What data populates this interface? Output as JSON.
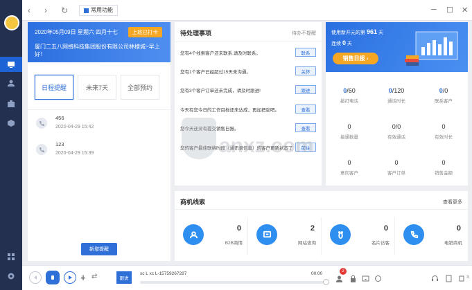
{
  "topbar": {
    "common_label": "常用功能"
  },
  "left": {
    "date_line": "2020年05月09日 星期六 四月十七",
    "checkin": "上班已打卡",
    "company": "厦门二五八网络科技集团股份有限公司林棣城~早上好！",
    "tabs": [
      "日程提醒",
      "未来7天",
      "全部预约"
    ],
    "reminders": [
      {
        "name": "456",
        "time": "2020-04-29 15:42"
      },
      {
        "name": "123",
        "time": "2020-04-29 15:39"
      }
    ],
    "add_button": "新增提醒"
  },
  "todo": {
    "title": "待处理事项",
    "filter": "待办不提醒",
    "items": [
      {
        "text": "您有4个线索客户还未联系,请及时联系。",
        "action": "联系"
      },
      {
        "text": "您有1个客户已经超过15天未沟通。",
        "action": "关怀"
      },
      {
        "text": "您有3个客户订单还未完成，请及时跟进!",
        "action": "跟进"
      },
      {
        "text": "今天有您今日的工作目标还未达成，再加把劲吧。",
        "action": "查看"
      },
      {
        "text": "您今天还没有提交销售日报。",
        "action": "查看"
      },
      {
        "text": "您的客户最佳联络时段（通讯录信息）的客户更新状态了",
        "action": "前往"
      }
    ]
  },
  "banner": {
    "days_prefix": "使用新开元的第",
    "days_value": "961",
    "days_suffix": "天",
    "streak_prefix": "连续",
    "streak_value": "0",
    "streak_suffix": "天",
    "daily_button": "销售日报"
  },
  "stats": [
    {
      "value": "0",
      "total": "/60",
      "label": "拨打电话"
    },
    {
      "value": "0",
      "total": "/120",
      "label": "通话时长"
    },
    {
      "value": "0",
      "total": "/0",
      "label": "联系客户"
    },
    {
      "value": "0",
      "total": "",
      "label": "接通数量"
    },
    {
      "value": "0",
      "total": "/0",
      "label": "有效通话"
    },
    {
      "value": "0",
      "total": "",
      "label": "有效时长"
    },
    {
      "value": "0",
      "total": "",
      "label": "意向客户"
    },
    {
      "value": "0",
      "total": "",
      "label": "客户订单"
    },
    {
      "value": "0",
      "total": "",
      "label": "销售金额"
    }
  ],
  "leads": {
    "title": "商机线索",
    "more": "查看更多",
    "cards": [
      {
        "icon": "user-icon",
        "value": "0",
        "label": "B2B商情"
      },
      {
        "icon": "chat-icon",
        "value": "2",
        "label": "网站咨询"
      },
      {
        "icon": "footprint-icon",
        "value": "0",
        "label": "名片访客"
      },
      {
        "icon": "phone-icon",
        "value": "0",
        "label": "电销商机"
      }
    ]
  },
  "callbar": {
    "follow": "跟进",
    "caller": "xc L   xc L-15759267287",
    "duration": "00:00",
    "progress": 0,
    "notify_count": "2",
    "queue_count": "3"
  },
  "colors": {
    "accent": "#2f6fd8",
    "sidebar": "#243050",
    "warn": "#f5a623"
  }
}
